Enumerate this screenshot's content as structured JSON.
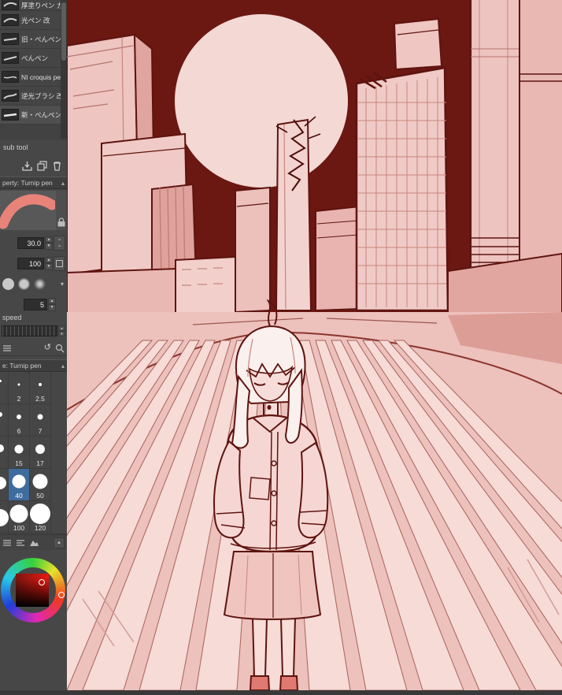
{
  "panel": {
    "tool_list": {
      "items": [
        {
          "label": "厚塗りペン ガ"
        },
        {
          "label": "光ペン 改"
        },
        {
          "label": "旧・ぺんペン"
        },
        {
          "label": "ぺんペン"
        },
        {
          "label": "NI croquis pen"
        },
        {
          "label": "逆光ブラシ 改"
        },
        {
          "label": "新・ぺんペン"
        }
      ]
    },
    "sub_tool_label": "sub tool",
    "tool_property": {
      "header": "perty: Turnip pen",
      "brush_size": "30.0",
      "opacity": "100",
      "stabilization": "5",
      "speed_label": "speed"
    },
    "brush_size_palette": {
      "header": "e: Turnip pen",
      "sizes": [
        "2",
        "2.5",
        "6",
        "7",
        "15",
        "17",
        "40",
        "50",
        "100",
        "120"
      ],
      "selected": "40"
    }
  },
  "colors": {
    "selection_blue": "#3f6c9e",
    "sky": "#6b1712",
    "moon": "#f3d8d4",
    "canvas_base_pink": "#eec5c0",
    "sketch_line": "#5e1410",
    "brush_preview_stroke": "#e8837a"
  }
}
